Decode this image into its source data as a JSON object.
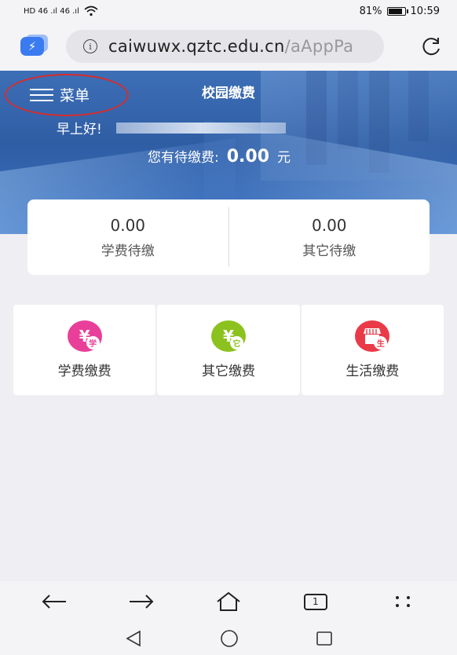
{
  "status": {
    "left": "HD 46 .ıl 46 .ıl",
    "battery": "81%",
    "battery_level": 0.81,
    "time": "10:59"
  },
  "browser": {
    "url": "caiwuwx.qztc.edu.cn",
    "url_rest": "/aAppPa",
    "tab_count": "1"
  },
  "header": {
    "menu_label": "菜单",
    "title": "校园缴费",
    "greeting": "早上好!",
    "pending_label": "您有待缴费:",
    "pending_amount": "0.00",
    "pending_unit": "元"
  },
  "summary": [
    {
      "value": "0.00",
      "label": "学费待缴"
    },
    {
      "value": "0.00",
      "label": "其它待缴"
    }
  ],
  "tiles": [
    {
      "label": "学费缴费",
      "badge": "学",
      "icon": "yuan-icon",
      "color": "#e8409a"
    },
    {
      "label": "其它缴费",
      "badge": "它",
      "icon": "yuan-icon",
      "color": "#8cc21f"
    },
    {
      "label": "生活缴费",
      "badge": "生",
      "icon": "store-icon",
      "color": "#ea3a48"
    }
  ],
  "colors": {
    "accent_circle": "#d62d2d",
    "hero": "#3d6fb6"
  }
}
